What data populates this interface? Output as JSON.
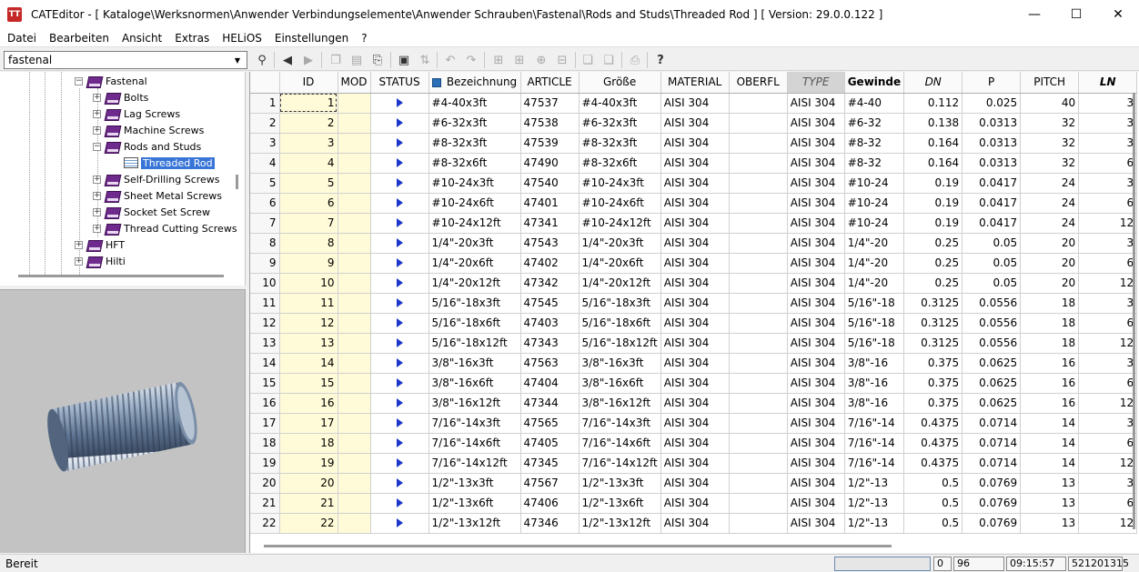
{
  "window": {
    "title": "CATEditor - [ Kataloge\\Werksnormen\\Anwender Verbindungselemente\\Anwender Schrauben\\Fastenal\\Rods and Studs\\Threaded Rod ]   [ Version: 29.0.0.122 ]",
    "icon": "app-logo-icon",
    "minimize": "—",
    "maximize": "☐",
    "close": "✕"
  },
  "menu": [
    "Datei",
    "Bearbeiten",
    "Ansicht",
    "Extras",
    "HELiOS",
    "Einstellungen",
    "?"
  ],
  "search": {
    "value": "fastenal"
  },
  "toolbar_icons": [
    "binoculars-icon",
    "back-icon",
    "forward-icon",
    "copy-icon",
    "document-icon",
    "paste-icon",
    "save-icon",
    "sort-icon",
    "undo-icon",
    "redo-icon",
    "add-row-icon",
    "add-column-icon",
    "insert-icon",
    "delete-icon",
    "clipboard-copy-icon",
    "clipboard-paste-icon",
    "print-icon",
    "help-icon"
  ],
  "tree": {
    "items": [
      {
        "label": "Fastenal",
        "level": 0,
        "expander": "−"
      },
      {
        "label": "Bolts",
        "level": 1,
        "expander": "+"
      },
      {
        "label": "Lag Screws",
        "level": 1,
        "expander": "+"
      },
      {
        "label": "Machine Screws",
        "level": 1,
        "expander": "+"
      },
      {
        "label": "Rods and Studs",
        "level": 1,
        "expander": "−"
      },
      {
        "label": "Threaded Rod",
        "level": 2,
        "selected": true
      },
      {
        "label": "Self-Drilling Screws",
        "level": 1,
        "expander": "+"
      },
      {
        "label": "Sheet Metal Screws",
        "level": 1,
        "expander": "+"
      },
      {
        "label": "Socket Set Screw",
        "level": 1,
        "expander": "+"
      },
      {
        "label": "Thread Cutting Screws",
        "level": 1,
        "expander": "+"
      },
      {
        "label": "HFT",
        "level": 0,
        "expander": "+"
      },
      {
        "label": "Hilti",
        "level": 0,
        "expander": "+"
      }
    ]
  },
  "grid": {
    "columns": [
      "",
      "ID",
      "MOD",
      "STATUS",
      "Bezeichnung",
      "ARTICLE",
      "Größe",
      "MATERIAL",
      "OBERFL",
      "TYPE",
      "Gewinde",
      "DN",
      "P",
      "PITCH",
      "LN"
    ],
    "rows": [
      [
        "1",
        "1",
        "",
        "",
        "#4-40x3ft",
        "47537",
        "#4-40x3ft",
        "AISI 304",
        "",
        "AISI 304",
        "#4-40",
        "0.112",
        "0.025",
        "40",
        "3"
      ],
      [
        "2",
        "2",
        "",
        "",
        "#6-32x3ft",
        "47538",
        "#6-32x3ft",
        "AISI 304",
        "",
        "AISI 304",
        "#6-32",
        "0.138",
        "0.0313",
        "32",
        "3"
      ],
      [
        "3",
        "3",
        "",
        "",
        "#8-32x3ft",
        "47539",
        "#8-32x3ft",
        "AISI 304",
        "",
        "AISI 304",
        "#8-32",
        "0.164",
        "0.0313",
        "32",
        "3"
      ],
      [
        "4",
        "4",
        "",
        "",
        "#8-32x6ft",
        "47490",
        "#8-32x6ft",
        "AISI 304",
        "",
        "AISI 304",
        "#8-32",
        "0.164",
        "0.0313",
        "32",
        "6"
      ],
      [
        "5",
        "5",
        "",
        "",
        "#10-24x3ft",
        "47540",
        "#10-24x3ft",
        "AISI 304",
        "",
        "AISI 304",
        "#10-24",
        "0.19",
        "0.0417",
        "24",
        "3"
      ],
      [
        "6",
        "6",
        "",
        "",
        "#10-24x6ft",
        "47401",
        "#10-24x6ft",
        "AISI 304",
        "",
        "AISI 304",
        "#10-24",
        "0.19",
        "0.0417",
        "24",
        "6"
      ],
      [
        "7",
        "7",
        "",
        "",
        "#10-24x12ft",
        "47341",
        "#10-24x12ft",
        "AISI 304",
        "",
        "AISI 304",
        "#10-24",
        "0.19",
        "0.0417",
        "24",
        "12"
      ],
      [
        "8",
        "8",
        "",
        "",
        "1/4\"-20x3ft",
        "47543",
        "1/4\"-20x3ft",
        "AISI 304",
        "",
        "AISI 304",
        "1/4\"-20",
        "0.25",
        "0.05",
        "20",
        "3"
      ],
      [
        "9",
        "9",
        "",
        "",
        "1/4\"-20x6ft",
        "47402",
        "1/4\"-20x6ft",
        "AISI 304",
        "",
        "AISI 304",
        "1/4\"-20",
        "0.25",
        "0.05",
        "20",
        "6"
      ],
      [
        "10",
        "10",
        "",
        "",
        "1/4\"-20x12ft",
        "47342",
        "1/4\"-20x12ft",
        "AISI 304",
        "",
        "AISI 304",
        "1/4\"-20",
        "0.25",
        "0.05",
        "20",
        "12"
      ],
      [
        "11",
        "11",
        "",
        "",
        "5/16\"-18x3ft",
        "47545",
        "5/16\"-18x3ft",
        "AISI 304",
        "",
        "AISI 304",
        "5/16\"-18",
        "0.3125",
        "0.0556",
        "18",
        "3"
      ],
      [
        "12",
        "12",
        "",
        "",
        "5/16\"-18x6ft",
        "47403",
        "5/16\"-18x6ft",
        "AISI 304",
        "",
        "AISI 304",
        "5/16\"-18",
        "0.3125",
        "0.0556",
        "18",
        "6"
      ],
      [
        "13",
        "13",
        "",
        "",
        "5/16\"-18x12ft",
        "47343",
        "5/16\"-18x12ft",
        "AISI 304",
        "",
        "AISI 304",
        "5/16\"-18",
        "0.3125",
        "0.0556",
        "18",
        "12"
      ],
      [
        "14",
        "14",
        "",
        "",
        "3/8\"-16x3ft",
        "47563",
        "3/8\"-16x3ft",
        "AISI 304",
        "",
        "AISI 304",
        "3/8\"-16",
        "0.375",
        "0.0625",
        "16",
        "3"
      ],
      [
        "15",
        "15",
        "",
        "",
        "3/8\"-16x6ft",
        "47404",
        "3/8\"-16x6ft",
        "AISI 304",
        "",
        "AISI 304",
        "3/8\"-16",
        "0.375",
        "0.0625",
        "16",
        "6"
      ],
      [
        "16",
        "16",
        "",
        "",
        "3/8\"-16x12ft",
        "47344",
        "3/8\"-16x12ft",
        "AISI 304",
        "",
        "AISI 304",
        "3/8\"-16",
        "0.375",
        "0.0625",
        "16",
        "12"
      ],
      [
        "17",
        "17",
        "",
        "",
        "7/16\"-14x3ft",
        "47565",
        "7/16\"-14x3ft",
        "AISI 304",
        "",
        "AISI 304",
        "7/16\"-14",
        "0.4375",
        "0.0714",
        "14",
        "3"
      ],
      [
        "18",
        "18",
        "",
        "",
        "7/16\"-14x6ft",
        "47405",
        "7/16\"-14x6ft",
        "AISI 304",
        "",
        "AISI 304",
        "7/16\"-14",
        "0.4375",
        "0.0714",
        "14",
        "6"
      ],
      [
        "19",
        "19",
        "",
        "",
        "7/16\"-14x12ft",
        "47345",
        "7/16\"-14x12ft",
        "AISI 304",
        "",
        "AISI 304",
        "7/16\"-14",
        "0.4375",
        "0.0714",
        "14",
        "12"
      ],
      [
        "20",
        "20",
        "",
        "",
        "1/2\"-13x3ft",
        "47567",
        "1/2\"-13x3ft",
        "AISI 304",
        "",
        "AISI 304",
        "1/2\"-13",
        "0.5",
        "0.0769",
        "13",
        "3"
      ],
      [
        "21",
        "21",
        "",
        "",
        "1/2\"-13x6ft",
        "47406",
        "1/2\"-13x6ft",
        "AISI 304",
        "",
        "AISI 304",
        "1/2\"-13",
        "0.5",
        "0.0769",
        "13",
        "6"
      ],
      [
        "22",
        "22",
        "",
        "",
        "1/2\"-13x12ft",
        "47346",
        "1/2\"-13x12ft",
        "AISI 304",
        "",
        "AISI 304",
        "1/2\"-13",
        "0.5",
        "0.0769",
        "13",
        "12"
      ]
    ]
  },
  "statusbar": {
    "text": "Bereit",
    "mod_count": "0",
    "row_count": "96",
    "time": "09:15:57",
    "code": "521201315"
  }
}
